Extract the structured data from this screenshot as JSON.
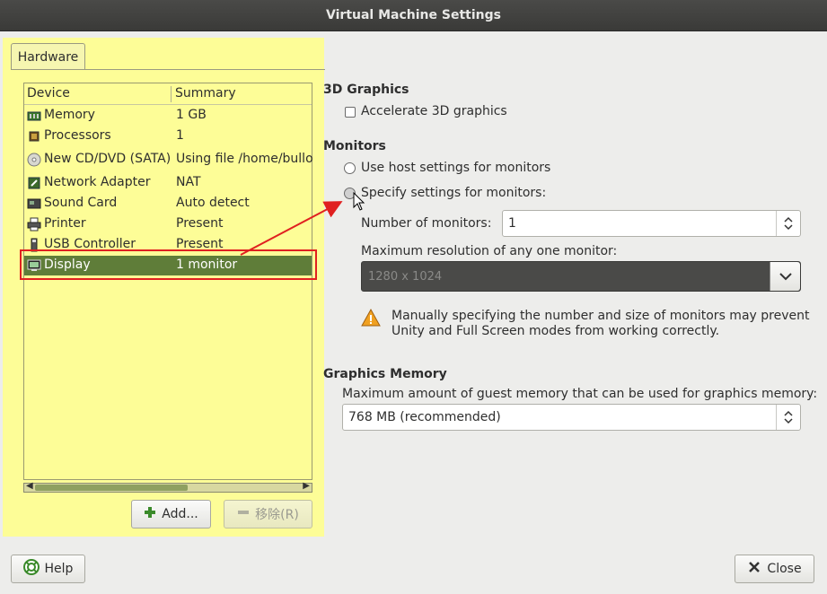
{
  "window": {
    "title": "Virtual Machine Settings"
  },
  "tabs": [
    {
      "label": "Hardware"
    }
  ],
  "device_list": {
    "columns": [
      "Device",
      "Summary"
    ],
    "rows": [
      {
        "icon": "memory-icon",
        "device": "Memory",
        "summary": "1 GB"
      },
      {
        "icon": "processor-icon",
        "device": "Processors",
        "summary": "1"
      },
      {
        "icon": "cd-dvd-icon",
        "device": "New CD/DVD (SATA)",
        "summary": "Using file /home/bullo"
      },
      {
        "icon": "network-adapter-icon",
        "device": "Network Adapter",
        "summary": "NAT"
      },
      {
        "icon": "sound-card-icon",
        "device": "Sound Card",
        "summary": "Auto detect"
      },
      {
        "icon": "printer-icon",
        "device": "Printer",
        "summary": "Present"
      },
      {
        "icon": "usb-icon",
        "device": "USB Controller",
        "summary": "Present"
      },
      {
        "icon": "display-icon",
        "device": "Display",
        "summary": "1 monitor",
        "selected": true
      }
    ]
  },
  "buttons": {
    "add": "Add...",
    "remove": "移除(R)",
    "help": "Help",
    "close": "Close"
  },
  "graphics3d": {
    "title": "3D Graphics",
    "accelerate_label": "Accelerate 3D graphics",
    "accelerate_checked": false
  },
  "monitors": {
    "title": "Monitors",
    "option_host": "Use host settings for monitors",
    "option_specify": "Specify settings for monitors:",
    "number_label": "Number of monitors:",
    "number_value": "1",
    "max_res_label": "Maximum resolution of any one monitor:",
    "max_res_value": "1280 x 1024",
    "warning_line1": "Manually specifying the number and size of monitors may prevent",
    "warning_line2": "Unity and Full Screen modes from working correctly."
  },
  "graphics_memory": {
    "title": "Graphics Memory",
    "label": "Maximum amount of guest memory that can be used for graphics memory:",
    "value": "768 MB (recommended)"
  },
  "colors": {
    "highlight": "#ffff88",
    "selection": "#5f7d39",
    "annotation": "#e02020"
  }
}
